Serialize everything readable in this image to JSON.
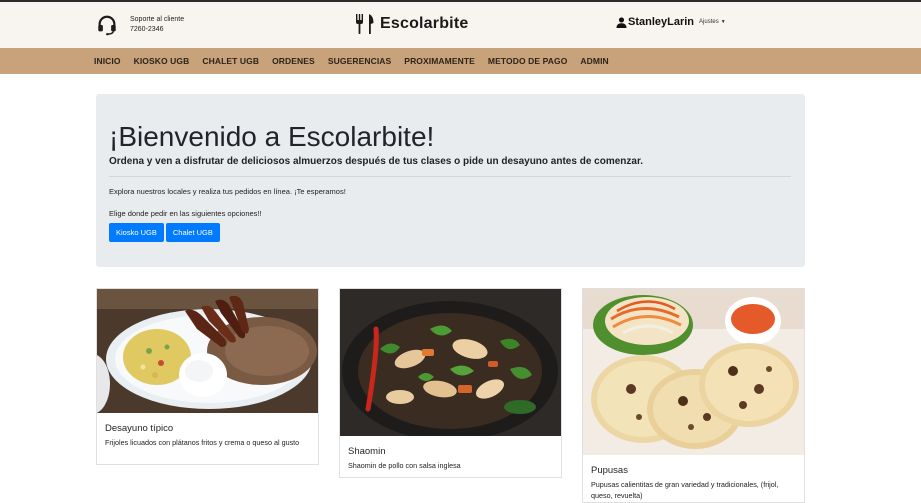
{
  "header": {
    "support_label": "Soporte al cliente",
    "support_phone": "7260-2346",
    "brand": "Escolarbite",
    "username": "StanleyLarin",
    "settings_label": "Ajustes"
  },
  "nav": {
    "items": [
      "INICIO",
      "KIOSKO UGB",
      "CHALET UGB",
      "ORDENES",
      "SUGERENCIAS",
      "PROXIMAMENTE",
      "METODO DE PAGO",
      "ADMIN"
    ]
  },
  "jumbotron": {
    "title": "¡Bienvenido a Escolarbite!",
    "lead": "Ordena y ven a disfrutar de deliciosos almuerzos después de tus clases o pide un desayuno antes de comenzar.",
    "text1": "Explora nuestros locales y realiza tus pedidos en línea. ¡Te esperamos!",
    "text2": "Elige donde pedir en las siguientes opciones!!",
    "buttons": [
      "Kiosko UGB",
      "Chalet UGB"
    ],
    "button_color": "#007bff"
  },
  "cards": [
    {
      "title": "Desayuno típico",
      "text": "Frijoles licuados con plátanos fritos y crema o queso al gusto"
    },
    {
      "title": "Shaomin",
      "text": "Shaomin de pollo con salsa inglesa"
    },
    {
      "title": "Pupusas",
      "text": "Pupusas calientitas de gran variedad y tradicionales, (frijol, queso, revuelta)"
    }
  ],
  "colors": {
    "nav_bg": "#c8a27a",
    "header_bg": "#f8f4ef",
    "jumbotron_bg": "#e9ecef"
  }
}
